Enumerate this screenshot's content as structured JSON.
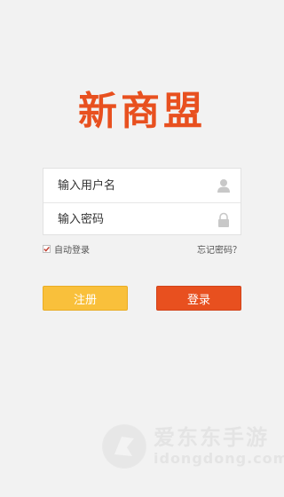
{
  "app": {
    "logo_text": "新商盟"
  },
  "form": {
    "username_placeholder": "输入用户名",
    "password_placeholder": "输入密码"
  },
  "options": {
    "auto_login_label": "自动登录",
    "auto_login_checked": true,
    "forgot_password_label": "忘记密码？"
  },
  "buttons": {
    "register_label": "注册",
    "login_label": "登录"
  },
  "watermark": {
    "cn_text": "爱东东手游",
    "en_text": "idongdong.com"
  },
  "colors": {
    "brand": "#e8501f",
    "register": "#f9c03b",
    "background": "#f2f2f2"
  },
  "icons": {
    "username": "user-icon",
    "password": "lock-icon",
    "watermark": "idongdong-logo-icon"
  }
}
